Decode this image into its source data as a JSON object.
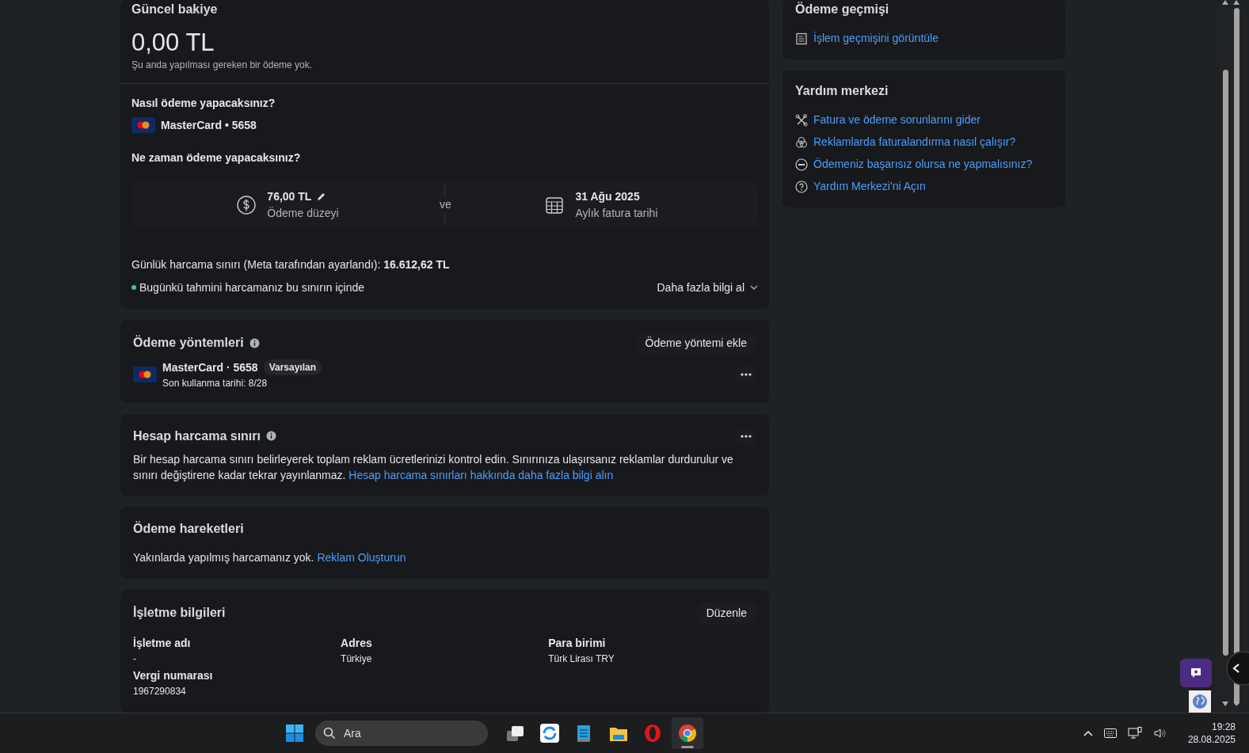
{
  "balance_card": {
    "title": "Güncel bakiye",
    "amount": "0,00 TL",
    "note": "Şu anda yapılması gereken bir ödeme yok.",
    "how_label": "Nasıl ödeme yapacaksınız?",
    "card_text": "MasterCard • 5658",
    "when_label": "Ne zaman ödeme yapacaksınız?",
    "threshold": {
      "value": "76,00 TL",
      "label": "Ödeme düzeyi"
    },
    "connector": "ve",
    "bill_date": {
      "value": "31 Ağu 2025",
      "label": "Aylık fatura tarihi"
    },
    "daily_limit": "Günlük harcama sınırı (Meta tarafından ayarlandı): **16.612,62 TL**",
    "status": {
      "text": "Bugünkü tahmini harcamanız bu sınırın içinde",
      "color": "#31d67b"
    },
    "more_info": "Daha fazla bilgi al"
  },
  "payment_methods": {
    "title": "Ödeme yöntemleri",
    "add_button": "Ödeme yöntemi ekle",
    "methods": [
      {
        "name": "MasterCard · 5658",
        "badge": "Varsayılan",
        "expiry": "Son kullanma tarihi: 8/28"
      }
    ]
  },
  "spending_limit": {
    "title": "Hesap harcama sınırı",
    "body": "Bir hesap harcama sınırı belirleyerek toplam reklam ücretlerinizi kontrol edin. Sınırınıza ulaşırsanız reklamlar durdurulur ve sınırı değiştirene kadar tekrar yayınlanmaz.",
    "link": "Hesap harcama sınırları hakkında daha fazla bilgi alın"
  },
  "activity": {
    "title": "Ödeme hareketleri",
    "body": "Yakınlarda yapılmış harcamanız yok.",
    "link": "Reklam Oluşturun"
  },
  "business_info": {
    "title": "İşletme bilgileri",
    "edit_button": "Düzenle",
    "columns": [
      [
        {
          "label": "İşletme adı",
          "value": "-"
        },
        {
          "label": "Vergi numarası",
          "value": "1967290834"
        }
      ],
      [
        {
          "label": "Adres",
          "value": "Türkiye"
        }
      ],
      [
        {
          "label": "Para birimi",
          "value": "Türk Lirası TRY"
        }
      ]
    ]
  },
  "sidebar": [
    {
      "title": "Ödeme geçmişi",
      "links": [
        {
          "text": "İşlem geçmişini görüntüle",
          "kind": "receipt"
        }
      ]
    },
    {
      "title": "Yardım merkezi",
      "links": [
        {
          "text": "Fatura ve ödeme sorunlarını gider",
          "kind": "tools"
        },
        {
          "text": "Reklamlarda faturalandırma nasıl çalışır?",
          "kind": "circles"
        },
        {
          "text": "Ödemeniz başarısız olursa ne yapmalısınız?",
          "kind": "minus"
        },
        {
          "text": "Yardım Merkezi'ni Açın",
          "kind": "question"
        }
      ]
    }
  ],
  "taskbar": {
    "search_placeholder": "Ara",
    "apps": [
      {
        "kind": "taskview",
        "selected": false
      },
      {
        "kind": "sync",
        "selected": false
      },
      {
        "kind": "notepad",
        "selected": false
      },
      {
        "kind": "folder",
        "selected": false
      },
      {
        "kind": "opera",
        "selected": false
      },
      {
        "kind": "chrome",
        "selected": true
      }
    ],
    "time": "19:28",
    "date": "28.08.2025"
  }
}
